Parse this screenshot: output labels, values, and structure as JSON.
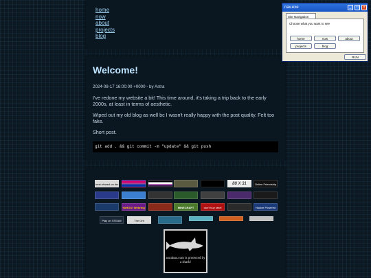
{
  "nav": {
    "links": [
      "home",
      "now",
      "about",
      "projects",
      "blog"
    ]
  },
  "post": {
    "title": "Welcome!",
    "meta": "2024-08-17 16:00:00 +0000 - by Astra",
    "paragraphs": [
      "I've redone my website a bit! This time around, it's taking a trip back to the early 2000s, at least in terms of aesthetic.",
      "Wiped out my old blog as well bc I wasn't really happy with the post quality. Felt too fake.",
      "Short post."
    ],
    "code": "git add . && git commit -m \"update\" && git push"
  },
  "badges": {
    "row1": [
      "best viewed on desktop",
      "",
      "",
      "",
      "",
      "",
      "88 X 31",
      "Online Friendship"
    ],
    "row2": [
      "",
      "",
      "",
      "",
      "",
      "",
      "",
      ""
    ],
    "row3": [
      "",
      "YAHOO! Webring",
      "",
      "MINECRAFT",
      "don't buy steel",
      "",
      "",
      "Hacker Powered"
    ],
    "row4": [
      "Play on STEAM",
      "The Orb",
      "",
      "",
      "",
      ""
    ]
  },
  "shark": {
    "text": "astraban.com is protected by a shark!"
  },
  "window": {
    "title": "nav.exe",
    "tab": "Site Navigation",
    "label": "Choose what you want to see",
    "buttons": [
      "home",
      "now",
      "about",
      "projects",
      "blog"
    ],
    "action": "RUN"
  },
  "colors": {
    "link": "#9ed0f0",
    "title": "#bfe4ff",
    "bg": "#0c1822"
  }
}
